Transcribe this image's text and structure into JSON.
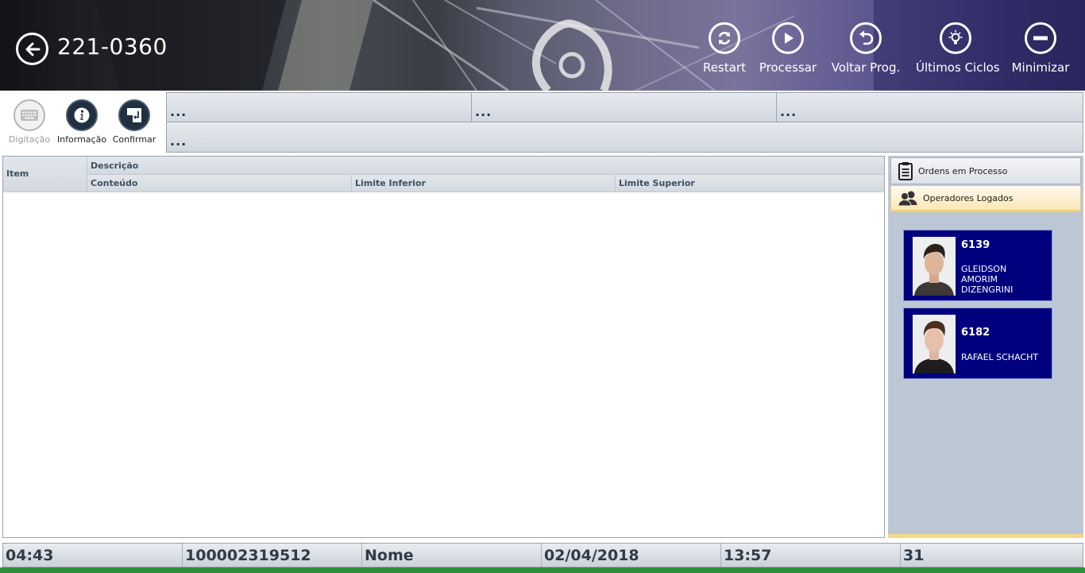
{
  "header": {
    "title": "221-0360",
    "buttons": [
      {
        "label": "Restart",
        "icon": "refresh-icon"
      },
      {
        "label": "Processar",
        "icon": "play-icon"
      },
      {
        "label": "Voltar Prog.",
        "icon": "undo-icon"
      },
      {
        "label": "Últimos Ciclos",
        "icon": "lightbulb-icon"
      },
      {
        "label": "Minimizar",
        "icon": "minus-icon"
      }
    ]
  },
  "toolbar": {
    "buttons": [
      {
        "label": "Digitação",
        "icon": "keyboard-icon",
        "enabled": false
      },
      {
        "label": "Informação",
        "icon": "info-icon",
        "enabled": true
      },
      {
        "label": "Confirmar",
        "icon": "enter-icon",
        "enabled": true
      }
    ]
  },
  "info_fields": [
    "...",
    "...",
    "...",
    "..."
  ],
  "table": {
    "headers": {
      "item": "Item",
      "descricao": "Descrição",
      "conteudo": "Conteúdo",
      "limite_inferior": "Limite Inferior",
      "limite_superior": "Limite Superior"
    },
    "rows": []
  },
  "side_panel": {
    "tabs": [
      {
        "label": "Ordens em Processo",
        "icon": "clipboard-icon",
        "active": false
      },
      {
        "label": "Operadores Logados",
        "icon": "users-icon",
        "active": true
      }
    ],
    "operators": [
      {
        "code": "6139",
        "name": [
          "GLEIDSON",
          "AMORIM",
          "DIZENGRINI"
        ]
      },
      {
        "code": "6182",
        "name": [
          "RAFAEL SCHACHT"
        ]
      }
    ]
  },
  "status_bar": [
    "04:43",
    "100002319512",
    "Nome",
    "02/04/2018",
    "13:57",
    "31"
  ],
  "colors": {
    "operator_card": "#00007F",
    "active_tab": "#FBE7B5",
    "side_panel": "#BCC7D6",
    "bottom_bar": "#2F8F3A"
  }
}
